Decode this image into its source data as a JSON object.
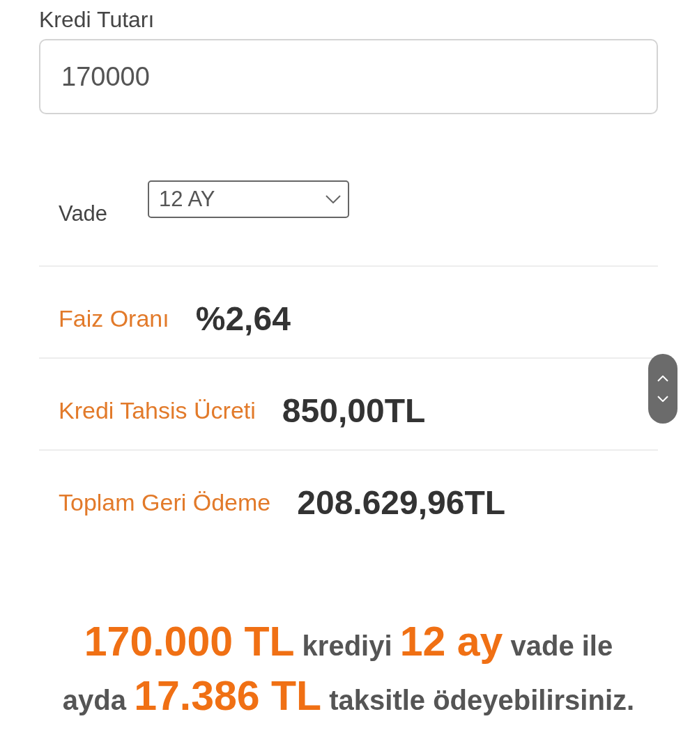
{
  "loan_amount": {
    "label": "Kredi Tutarı",
    "value": "170000"
  },
  "term": {
    "label": "Vade",
    "value": "12 AY"
  },
  "details": [
    {
      "label": "Faiz Oranı",
      "value": "%2,64"
    },
    {
      "label": "Kredi Tahsis Ücreti",
      "value": "850,00TL"
    },
    {
      "label": "Toplam Geri Ödeme",
      "value": "208.629,96TL"
    }
  ],
  "summary": "**170.000 TL** krediyi **12 ay** vade ile ayda **17.386 TL** taksitle ödeyebilirsiniz."
}
